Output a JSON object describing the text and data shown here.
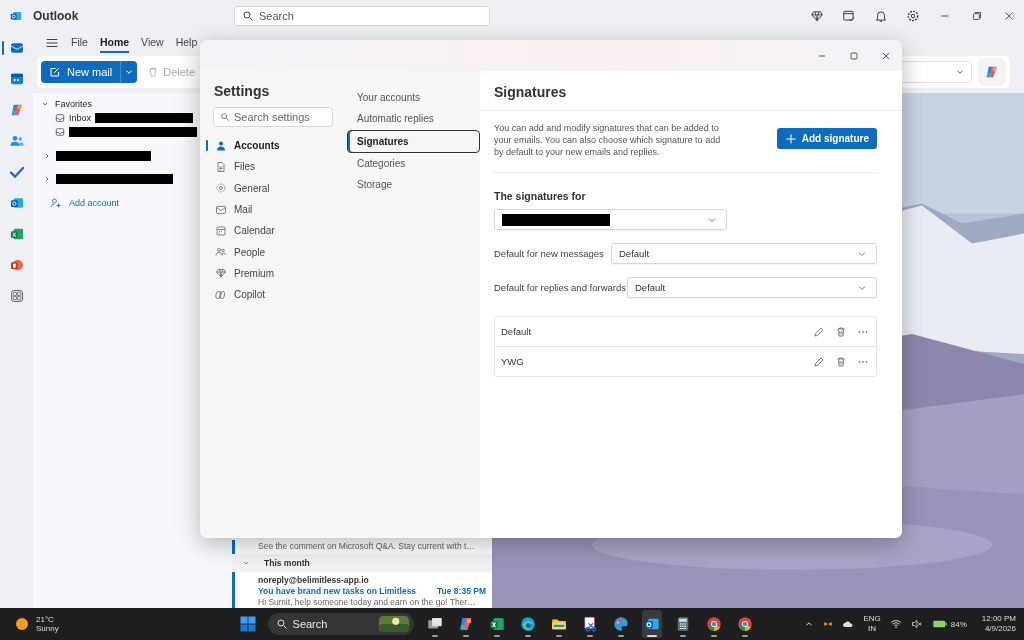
{
  "app": {
    "title": "Outlook",
    "search_placeholder": "Search"
  },
  "rail": [
    {
      "kind": "mail",
      "selected": true
    },
    {
      "kind": "calendar",
      "selected": false
    },
    {
      "kind": "copilot",
      "selected": false
    },
    {
      "kind": "people",
      "selected": false
    },
    {
      "kind": "todo",
      "selected": false
    },
    {
      "kind": "outlook",
      "selected": false
    },
    {
      "kind": "excel",
      "selected": false
    },
    {
      "kind": "powerpoint",
      "selected": false
    },
    {
      "kind": "apps",
      "selected": false
    }
  ],
  "ribbon": {
    "tabs": [
      {
        "label": "File",
        "selected": false
      },
      {
        "label": "Home",
        "selected": true
      },
      {
        "label": "View",
        "selected": false
      },
      {
        "label": "Help",
        "selected": false
      }
    ],
    "new_mail": "New mail",
    "delete": "Delete"
  },
  "folders": {
    "favorites_label": "Favorites",
    "favorites": [
      {
        "label": "Inbox",
        "redacted": true
      },
      {
        "redacted": true
      }
    ],
    "accounts": [
      {
        "redacted": true
      },
      {
        "redacted": true
      }
    ],
    "add_account": "Add account"
  },
  "message_list": {
    "preview_tail": "See the comment on Microsoft Q&A. Stay current with t…",
    "group": "This month",
    "message": {
      "sender": "noreply@belimitless-app.io",
      "subject": "You have brand new tasks on Limitless",
      "time": "Tue 8:35 PM",
      "preview": "Hi Sumit, help someone today and earn on the go! Ther…"
    }
  },
  "settings": {
    "title": "Settings",
    "search_placeholder": "Search settings",
    "categories": [
      {
        "label": "Accounts",
        "selected": true
      },
      {
        "label": "Files",
        "selected": false
      },
      {
        "label": "General",
        "selected": false
      },
      {
        "label": "Mail",
        "selected": false
      },
      {
        "label": "Calendar",
        "selected": false
      },
      {
        "label": "People",
        "selected": false
      },
      {
        "label": "Premium",
        "selected": false
      },
      {
        "label": "Copilot",
        "selected": false
      }
    ],
    "subcategories": [
      {
        "label": "Your accounts",
        "selected": false
      },
      {
        "label": "Automatic replies",
        "selected": false
      },
      {
        "label": "Signatures",
        "selected": true
      },
      {
        "label": "Categories",
        "selected": false
      },
      {
        "label": "Storage",
        "selected": false
      }
    ],
    "page": {
      "title": "Signatures",
      "description": "You can add and modify signatures that can be added to your emails. You can also choose which signature to add by default to your new emails and replies.",
      "add_button": "Add signature",
      "signatures_for_label": "The signatures for",
      "account_redacted": true,
      "defaults": [
        {
          "label": "Default for new messages",
          "value": "Default"
        },
        {
          "label": "Default for replies and forwards",
          "value": "Default"
        }
      ],
      "signatures": [
        {
          "name": "Default"
        },
        {
          "name": "YWG"
        }
      ]
    }
  },
  "taskbar": {
    "weather": {
      "temperature": "21°C",
      "condition": "Sunny"
    },
    "search_placeholder": "Search",
    "apps": [
      {
        "kind": "taskview",
        "selected": false
      },
      {
        "kind": "copilot",
        "selected": false
      },
      {
        "kind": "excel",
        "selected": false
      },
      {
        "kind": "edge",
        "selected": false
      },
      {
        "kind": "files",
        "selected": false
      },
      {
        "kind": "snipping",
        "selected": false
      },
      {
        "kind": "paint",
        "selected": false
      },
      {
        "kind": "outlook",
        "selected": true
      },
      {
        "kind": "calculator",
        "selected": false
      },
      {
        "kind": "chrome",
        "selected": false
      },
      {
        "kind": "chrome",
        "selected": false
      }
    ],
    "tray": {
      "language": "ENG",
      "region": "IN",
      "battery": "84%",
      "time": "12:00 PM",
      "date": "4/9/2026"
    }
  }
}
